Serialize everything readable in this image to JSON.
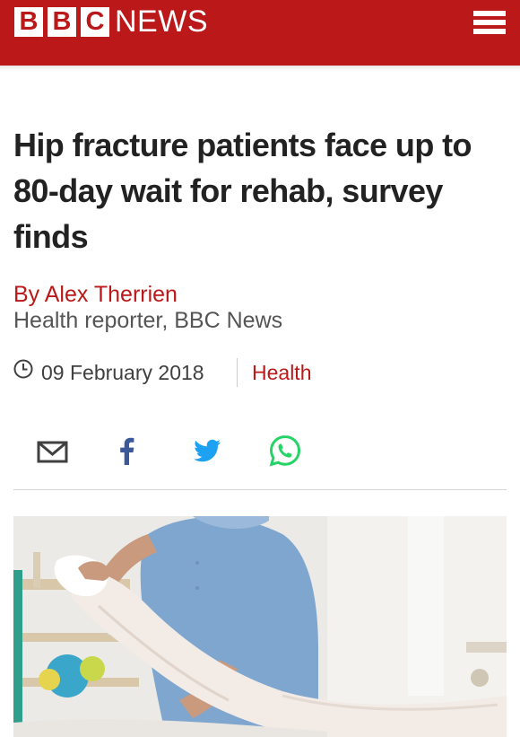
{
  "header": {
    "brand_letters": [
      "B",
      "B",
      "C"
    ],
    "brand_word": "NEWS",
    "menu_icon": "hamburger-menu-icon",
    "background_color": "#bb1919"
  },
  "article": {
    "headline": "Hip fracture patients face up to 80-day wait for rehab, survey finds",
    "byline": {
      "name": "By Alex Therrien",
      "role": "Health reporter, BBC News"
    },
    "meta": {
      "date_icon": "clock-icon",
      "date": "09 February 2018",
      "topic": "Health"
    },
    "share": [
      {
        "icon": "email-icon",
        "color": "#404040"
      },
      {
        "icon": "facebook-icon",
        "color": "#3b5998"
      },
      {
        "icon": "twitter-icon",
        "color": "#1da1f2"
      },
      {
        "icon": "whatsapp-icon",
        "color": "#25d366"
      }
    ],
    "lead_image": {
      "subject": "physiotherapist stretching a patient's leg"
    }
  },
  "colors": {
    "accent": "#bb1919",
    "headline": "#222222",
    "secondary_text": "#555555"
  }
}
